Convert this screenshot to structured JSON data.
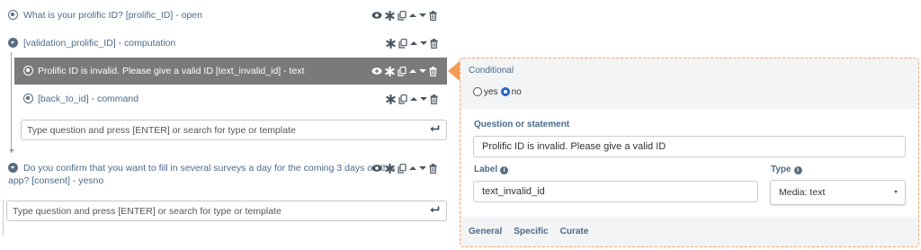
{
  "rows": [
    {
      "text": "What is your prolific ID? [prolific_ID] - open"
    },
    {
      "text": "[validation_prolific_ID] - computation"
    },
    {
      "text": "Prolific ID is invalid. Please give a valid ID [text_invalid_id] - text"
    },
    {
      "text": "[back_to_id] - command"
    },
    {
      "text_line1": "Do you confirm that you want to fill in several surveys a day for the coming 3 days on this",
      "text_line2": "app? [consent] - yesno"
    }
  ],
  "add_question_placeholder": "Type question and press [ENTER] or search for type or template",
  "panel": {
    "conditional_label": "Conditional",
    "options": [
      "yes",
      "no"
    ],
    "selected_option": "no",
    "question_label": "Question or statement",
    "question_value": "Prolific ID is invalid. Please give a valid ID",
    "label_label": "Label",
    "label_value": "text_invalid_id",
    "type_label": "Type",
    "type_value": "Media: text",
    "tabs": [
      "General",
      "Specific",
      "Curate"
    ]
  },
  "colors": {
    "selected_row_bg": "#7a7a7a",
    "accent_orange": "#f39a55",
    "text_blue": "#4b6a8a"
  },
  "icons": [
    "radio-icon",
    "down-arrow-icon",
    "eye-icon",
    "asterisk-icon",
    "copy-icon",
    "move-up-icon",
    "move-down-icon",
    "trash-icon",
    "enter-icon",
    "info-icon"
  ]
}
